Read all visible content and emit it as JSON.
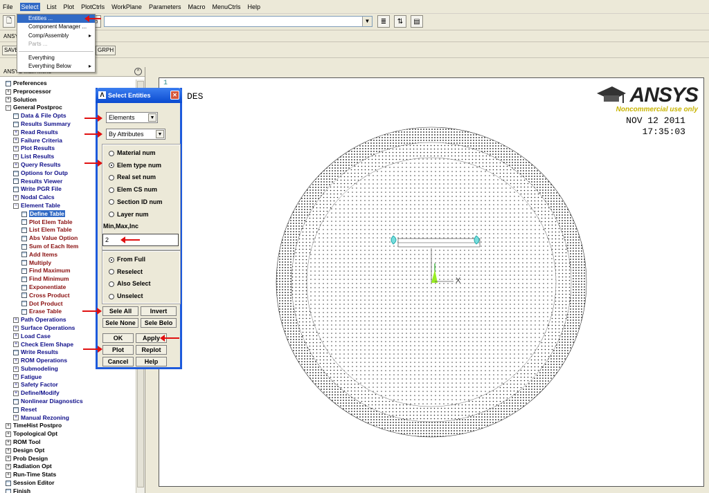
{
  "menubar": [
    "File",
    "Select",
    "List",
    "Plot",
    "PlotCtrls",
    "WorkPlane",
    "Parameters",
    "Macro",
    "MenuCtrls",
    "Help"
  ],
  "select_menu": {
    "items": [
      {
        "label": "Entities ...",
        "highlighted": true
      },
      {
        "label": "Component Manager ..."
      },
      {
        "label": "Comp/Assembly",
        "submenu": true
      },
      {
        "label": "Parts ...",
        "disabled": true
      },
      {
        "label": "Everything"
      },
      {
        "label": "Everything Below",
        "submenu": true
      }
    ]
  },
  "toolbar": {
    "row2_label": "ANSY",
    "save_btn": "SAVE",
    "grph_btn": "GRPH"
  },
  "main_menu": {
    "title": "ANSYS Main Menu",
    "items": [
      {
        "label": "Preferences",
        "level": 0,
        "icon": "table"
      },
      {
        "label": "Preprocessor",
        "level": 0,
        "icon": "plus"
      },
      {
        "label": "Solution",
        "level": 0,
        "icon": "plus"
      },
      {
        "label": "General Postproc",
        "level": 0,
        "icon": "minus"
      },
      {
        "label": "Data & File Opts",
        "level": 1,
        "icon": "table"
      },
      {
        "label": "Results Summary",
        "level": 1,
        "icon": "table"
      },
      {
        "label": "Read Results",
        "level": 1,
        "icon": "plus"
      },
      {
        "label": "Failure Criteria",
        "level": 1,
        "icon": "plus"
      },
      {
        "label": "Plot Results",
        "level": 1,
        "icon": "plus"
      },
      {
        "label": "List Results",
        "level": 1,
        "icon": "plus"
      },
      {
        "label": "Query Results",
        "level": 1,
        "icon": "plus"
      },
      {
        "label": "Options for Outp",
        "level": 1,
        "icon": "table"
      },
      {
        "label": "Results Viewer",
        "level": 1,
        "icon": "table"
      },
      {
        "label": "Write PGR File",
        "level": 1,
        "icon": "table"
      },
      {
        "label": "Nodal Calcs",
        "level": 1,
        "icon": "plus"
      },
      {
        "label": "Element Table",
        "level": 1,
        "icon": "minus"
      },
      {
        "label": "Define Table",
        "level": 2,
        "icon": "table",
        "selected": true
      },
      {
        "label": "Plot Elem Table",
        "level": 2,
        "icon": "table"
      },
      {
        "label": "List Elem Table",
        "level": 2,
        "icon": "table"
      },
      {
        "label": "Abs Value Option",
        "level": 2,
        "icon": "table"
      },
      {
        "label": "Sum of Each Item",
        "level": 2,
        "icon": "table"
      },
      {
        "label": "Add Items",
        "level": 2,
        "icon": "table"
      },
      {
        "label": "Multiply",
        "level": 2,
        "icon": "table"
      },
      {
        "label": "Find Maximum",
        "level": 2,
        "icon": "table"
      },
      {
        "label": "Find Minimum",
        "level": 2,
        "icon": "table"
      },
      {
        "label": "Exponentiate",
        "level": 2,
        "icon": "table"
      },
      {
        "label": "Cross Product",
        "level": 2,
        "icon": "table"
      },
      {
        "label": "Dot Product",
        "level": 2,
        "icon": "table"
      },
      {
        "label": "Erase Table",
        "level": 2,
        "icon": "table"
      },
      {
        "label": "Path Operations",
        "level": 1,
        "icon": "plus"
      },
      {
        "label": "Surface Operations",
        "level": 1,
        "icon": "plus"
      },
      {
        "label": "Load Case",
        "level": 1,
        "icon": "plus"
      },
      {
        "label": "Check Elem Shape",
        "level": 1,
        "icon": "plus"
      },
      {
        "label": "Write Results",
        "level": 1,
        "icon": "table"
      },
      {
        "label": "ROM Operations",
        "level": 1,
        "icon": "plus"
      },
      {
        "label": "Submodeling",
        "level": 1,
        "icon": "plus"
      },
      {
        "label": "Fatigue",
        "level": 1,
        "icon": "plus"
      },
      {
        "label": "Safety Factor",
        "level": 1,
        "icon": "plus"
      },
      {
        "label": "Define/Modify",
        "level": 1,
        "icon": "plus"
      },
      {
        "label": "Nonlinear Diagnostics",
        "level": 1,
        "icon": "table"
      },
      {
        "label": "Reset",
        "level": 1,
        "icon": "table"
      },
      {
        "label": "Manual Rezoning",
        "level": 1,
        "icon": "plus"
      },
      {
        "label": "TimeHist Postpro",
        "level": 0,
        "icon": "plus"
      },
      {
        "label": "Topological Opt",
        "level": 0,
        "icon": "plus"
      },
      {
        "label": "ROM Tool",
        "level": 0,
        "icon": "plus"
      },
      {
        "label": "Design Opt",
        "level": 0,
        "icon": "plus"
      },
      {
        "label": "Prob Design",
        "level": 0,
        "icon": "plus"
      },
      {
        "label": "Radiation Opt",
        "level": 0,
        "icon": "plus"
      },
      {
        "label": "Run-Time Stats",
        "level": 0,
        "icon": "plus"
      },
      {
        "label": "Session Editor",
        "level": 0,
        "icon": "table"
      },
      {
        "label": "Finish",
        "level": 0,
        "icon": "table"
      }
    ]
  },
  "dialog": {
    "title": "Select Entities",
    "entity_type": "Elements",
    "criterion": "By Attributes",
    "attributes": [
      {
        "label": "Material num",
        "checked": false
      },
      {
        "label": "Elem type num",
        "checked": true
      },
      {
        "label": "Real set num",
        "checked": false
      },
      {
        "label": "Elem CS num",
        "checked": false
      },
      {
        "label": "Section ID num",
        "checked": false
      },
      {
        "label": "Layer num",
        "checked": false
      }
    ],
    "range_label": "Min,Max,Inc",
    "range_value": "2",
    "modes": [
      {
        "label": "From Full",
        "checked": true
      },
      {
        "label": "Reselect",
        "checked": false
      },
      {
        "label": "Also Select",
        "checked": false
      },
      {
        "label": "Unselect",
        "checked": false
      }
    ],
    "buttons": {
      "sele_all": "Sele All",
      "invert": "Invert",
      "sele_none": "Sele None",
      "sele_belo": "Sele Belo",
      "ok": "OK",
      "apply": "Apply",
      "plot": "Plot",
      "replot": "Replot",
      "cancel": "Cancel",
      "help": "Help"
    }
  },
  "graphics": {
    "window_number": "1",
    "mode_label": "DES",
    "date": "NOV 12 2011",
    "time": "17:35:03",
    "logo_text": "ANSYS",
    "logo_subtext": "Noncommercial use only",
    "triad_label": "X"
  },
  "colors": {
    "accent": "#316ac5",
    "dialog_border": "#1d5adc",
    "annotation_arrow": "#e01010",
    "logo_yellow": "#c8b400"
  }
}
